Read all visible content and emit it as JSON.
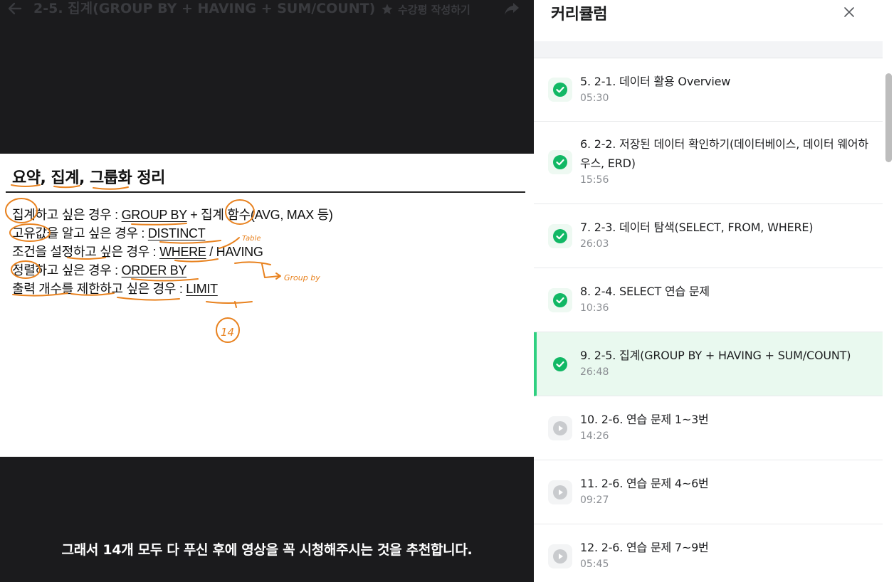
{
  "video": {
    "title": "2-5. 집계(GROUP BY + HAVING + SUM/COUNT)",
    "review_label": "수강평 작성하기",
    "subtitle": "그래서 14개 모두 다 푸신 후에 영상을 꼭 시청해주시는 것을 추천합니다."
  },
  "slide": {
    "title": "요약, 집계, 그룹화 정리",
    "lines": [
      {
        "prefix": "집계하고 싶은 경우 : ",
        "keyword": "GROUP BY",
        "suffix": " + 집계 함수(AVG, MAX 등)"
      },
      {
        "prefix": "고유값을 알고 싶은 경우 : ",
        "keyword": "DISTINCT",
        "suffix": ""
      },
      {
        "prefix": "조건을 설정하고 싶은 경우 : ",
        "keyword": "WHERE",
        "suffix": " / HAVING"
      },
      {
        "prefix": "정렬하고 싶은 경우 : ",
        "keyword": "ORDER BY",
        "suffix": ""
      },
      {
        "prefix": "출력 개수를 제한하고 싶은 경우 : ",
        "keyword": "LIMIT",
        "suffix": ""
      }
    ],
    "annotations": [
      "Table",
      "Group by",
      "14"
    ],
    "ink_color": "#e8821f"
  },
  "panel": {
    "title": "커리큘럼",
    "accent_color": "#2fd081",
    "lessons": [
      {
        "title": "5. 2-1. 데이터 활용 Overview",
        "time": "05:30",
        "status": "done"
      },
      {
        "title": "6. 2-2. 저장된 데이터 확인하기(데이터베이스, 데이터 웨어하우스, ERD)",
        "time": "15:56",
        "status": "done"
      },
      {
        "title": "7. 2-3. 데이터 탐색(SELECT, FROM, WHERE)",
        "time": "26:03",
        "status": "done"
      },
      {
        "title": "8. 2-4. SELECT 연습 문제",
        "time": "10:36",
        "status": "done"
      },
      {
        "title": "9. 2-5. 집계(GROUP BY + HAVING + SUM/COUNT)",
        "time": "26:48",
        "status": "current"
      },
      {
        "title": "10. 2-6. 연습 문제 1~3번",
        "time": "14:26",
        "status": "pending"
      },
      {
        "title": "11. 2-6. 연습 문제 4~6번",
        "time": "09:27",
        "status": "pending"
      },
      {
        "title": "12. 2-6. 연습 문제 7~9번",
        "time": "05:45",
        "status": "pending"
      }
    ]
  }
}
